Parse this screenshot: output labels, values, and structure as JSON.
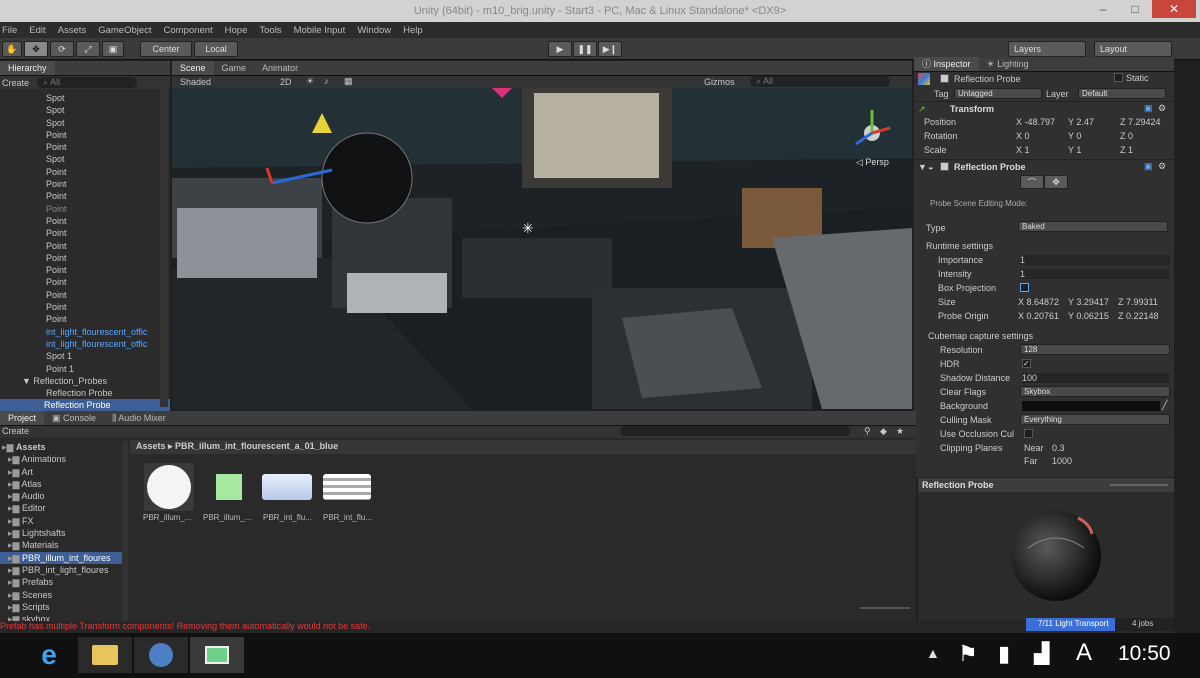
{
  "window": {
    "title": "Unity (64bit) - m10_brig.unity - Start3 - PC, Mac & Linux Standalone* <DX9>",
    "min": "–",
    "max": "□",
    "close": "✕"
  },
  "menu": [
    "File",
    "Edit",
    "Assets",
    "GameObject",
    "Component",
    "Hope",
    "Tools",
    "Mobile Input",
    "Window",
    "Help"
  ],
  "toolbar": {
    "center": "Center",
    "local": "Local",
    "layers": "Layers",
    "layout": "Layout"
  },
  "hierarchy": {
    "tab": "Hierarchy",
    "create": "Create",
    "search": "All",
    "items": [
      {
        "label": "Spot",
        "style": "normal"
      },
      {
        "label": "Spot",
        "style": "normal"
      },
      {
        "label": "Spot",
        "style": "normal"
      },
      {
        "label": "Point",
        "style": "normal"
      },
      {
        "label": "Point",
        "style": "normal"
      },
      {
        "label": "Spot",
        "style": "normal"
      },
      {
        "label": "Point",
        "style": "normal"
      },
      {
        "label": "Point",
        "style": "normal"
      },
      {
        "label": "Point",
        "style": "normal"
      },
      {
        "label": "Point",
        "style": "dim"
      },
      {
        "label": "Point",
        "style": "normal"
      },
      {
        "label": "Point",
        "style": "normal"
      },
      {
        "label": "Point",
        "style": "normal"
      },
      {
        "label": "Point",
        "style": "normal"
      },
      {
        "label": "Point",
        "style": "normal"
      },
      {
        "label": "Point",
        "style": "normal"
      },
      {
        "label": "Point",
        "style": "normal"
      },
      {
        "label": "Point",
        "style": "normal"
      },
      {
        "label": "Point",
        "style": "normal"
      },
      {
        "label": "int_light_flourescent_offic",
        "style": "blue"
      },
      {
        "label": "int_light_flourescent_offic",
        "style": "blue"
      },
      {
        "label": "Spot 1",
        "style": "normal"
      },
      {
        "label": "Point 1",
        "style": "normal"
      },
      {
        "label": "▼ Reflection_Probes",
        "style": "normal"
      },
      {
        "label": "Reflection Probe",
        "style": "normal"
      },
      {
        "label": "Reflection Probe",
        "style": "selected"
      }
    ]
  },
  "scene": {
    "tabs": [
      "Scene",
      "Game",
      "Animator"
    ],
    "shaded": "Shaded",
    "mode2d": "2D",
    "gizmos": "Gizmos",
    "search": "All",
    "persp": "◁ Persp"
  },
  "project": {
    "tabs": [
      "Project",
      "Console",
      "Audio Mixer"
    ],
    "create": "Create",
    "tree": [
      "Assets",
      "Animations",
      "Art",
      "Atlas",
      "Audio",
      "Editor",
      "FX",
      "Lightshafts",
      "Materials",
      "PBR_illum_int_floures",
      "PBR_int_light_floures",
      "Prefabs",
      "Scenes",
      "Scripts",
      "skybox"
    ],
    "breadcrumb": "Assets ▸ PBR_illum_int_flourescent_a_01_blue",
    "assets": [
      "PBR_illum_...",
      "PBR_illum_...",
      "PBR_int_flu...",
      "PBR_int_flu..."
    ]
  },
  "status": {
    "error": "Prefab has multiple Transform components! Removing them automatically would not be safe.",
    "progress": "7/11 Light Transport",
    "progress_fraction": 0.6,
    "jobs": "4 jobs"
  },
  "inspector": {
    "tabs": [
      "Inspector",
      "Lighting"
    ],
    "object_name": "Reflection Probe",
    "static": "Static",
    "tag_label": "Tag",
    "tag": "Untagged",
    "layer_label": "Layer",
    "layer": "Default",
    "transform": {
      "title": "Transform",
      "position_label": "Position",
      "position": {
        "x": "-48.797",
        "y": "2.47",
        "z": "7.29424"
      },
      "rotation_label": "Rotation",
      "rotation": {
        "x": "0",
        "y": "0",
        "z": "0"
      },
      "scale_label": "Scale",
      "scale": {
        "x": "1",
        "y": "1",
        "z": "1"
      }
    },
    "probe": {
      "title": "Reflection Probe",
      "editing_mode": "Probe Scene Editing Mode:",
      "type_label": "Type",
      "type": "Baked",
      "runtime": "Runtime settings",
      "importance_label": "Importance",
      "importance": "1",
      "intensity_label": "Intensity",
      "intensity": "1",
      "box_projection": "Box Projection",
      "size_label": "Size",
      "size": {
        "x": "8.64872",
        "y": "3.29417",
        "z": "7.99311"
      },
      "origin_label": "Probe Origin",
      "origin": {
        "x": "0.20761",
        "y": "0.06215",
        "z": "0.22148"
      },
      "cubemap": "Cubemap capture settings",
      "resolution_label": "Resolution",
      "resolution": "128",
      "hdr_label": "HDR",
      "shadow_label": "Shadow Distance",
      "shadow": "100",
      "clear_label": "Clear Flags",
      "clear": "Skybox",
      "background_label": "Background",
      "culling_label": "Culling Mask",
      "culling": "Everything",
      "occlusion_label": "Use Occlusion Cul",
      "clipping_label": "Clipping Planes",
      "near_label": "Near",
      "near": "0.3",
      "far_label": "Far",
      "far": "1000"
    },
    "preview_title": "Reflection Probe"
  },
  "taskbar": {
    "time": "10:50",
    "ime": "A"
  },
  "colors": {
    "accent_blue": "#5aa7ff",
    "error": "#e23b3b",
    "progress": "#3b6fd6",
    "close": "#c9463d"
  }
}
